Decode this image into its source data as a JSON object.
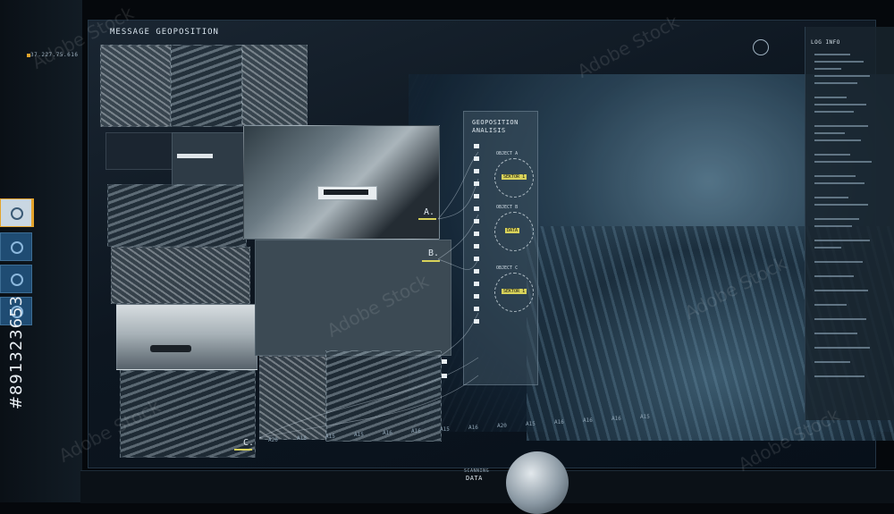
{
  "header": {
    "panel_title": "MESSAGE GEOPOSITION",
    "coords": "37.227.75.616"
  },
  "geo_panel": {
    "title_line1": "GEOPOSITION",
    "title_line2": "ANALISIS",
    "objects": [
      {
        "name": "OBJECT A",
        "tag": "SEKTOR 1"
      },
      {
        "name": "OBJECT B",
        "tag": "DATA"
      },
      {
        "name": "OBJECT C",
        "tag": "SEKTOR 1"
      }
    ]
  },
  "markers": {
    "a": "A.",
    "b": "B.",
    "c": "C."
  },
  "log_panel": {
    "title": "LOG INFO"
  },
  "timeline": {
    "ticks": [
      "A20",
      "A18",
      "A15",
      "A15",
      "A16",
      "A16",
      "A15",
      "A16",
      "A20",
      "A15",
      "A16",
      "A16",
      "A16",
      "A15"
    ]
  },
  "footer": {
    "scanning_label": "SCANNING",
    "data_label": "DATA"
  },
  "watermark": {
    "brand": "Adobe Stock",
    "id_text": "#891323653"
  },
  "colors": {
    "accent_yellow": "#d8d25a",
    "button_blue": "#1f4c73",
    "selected_border": "#e4a42c"
  }
}
